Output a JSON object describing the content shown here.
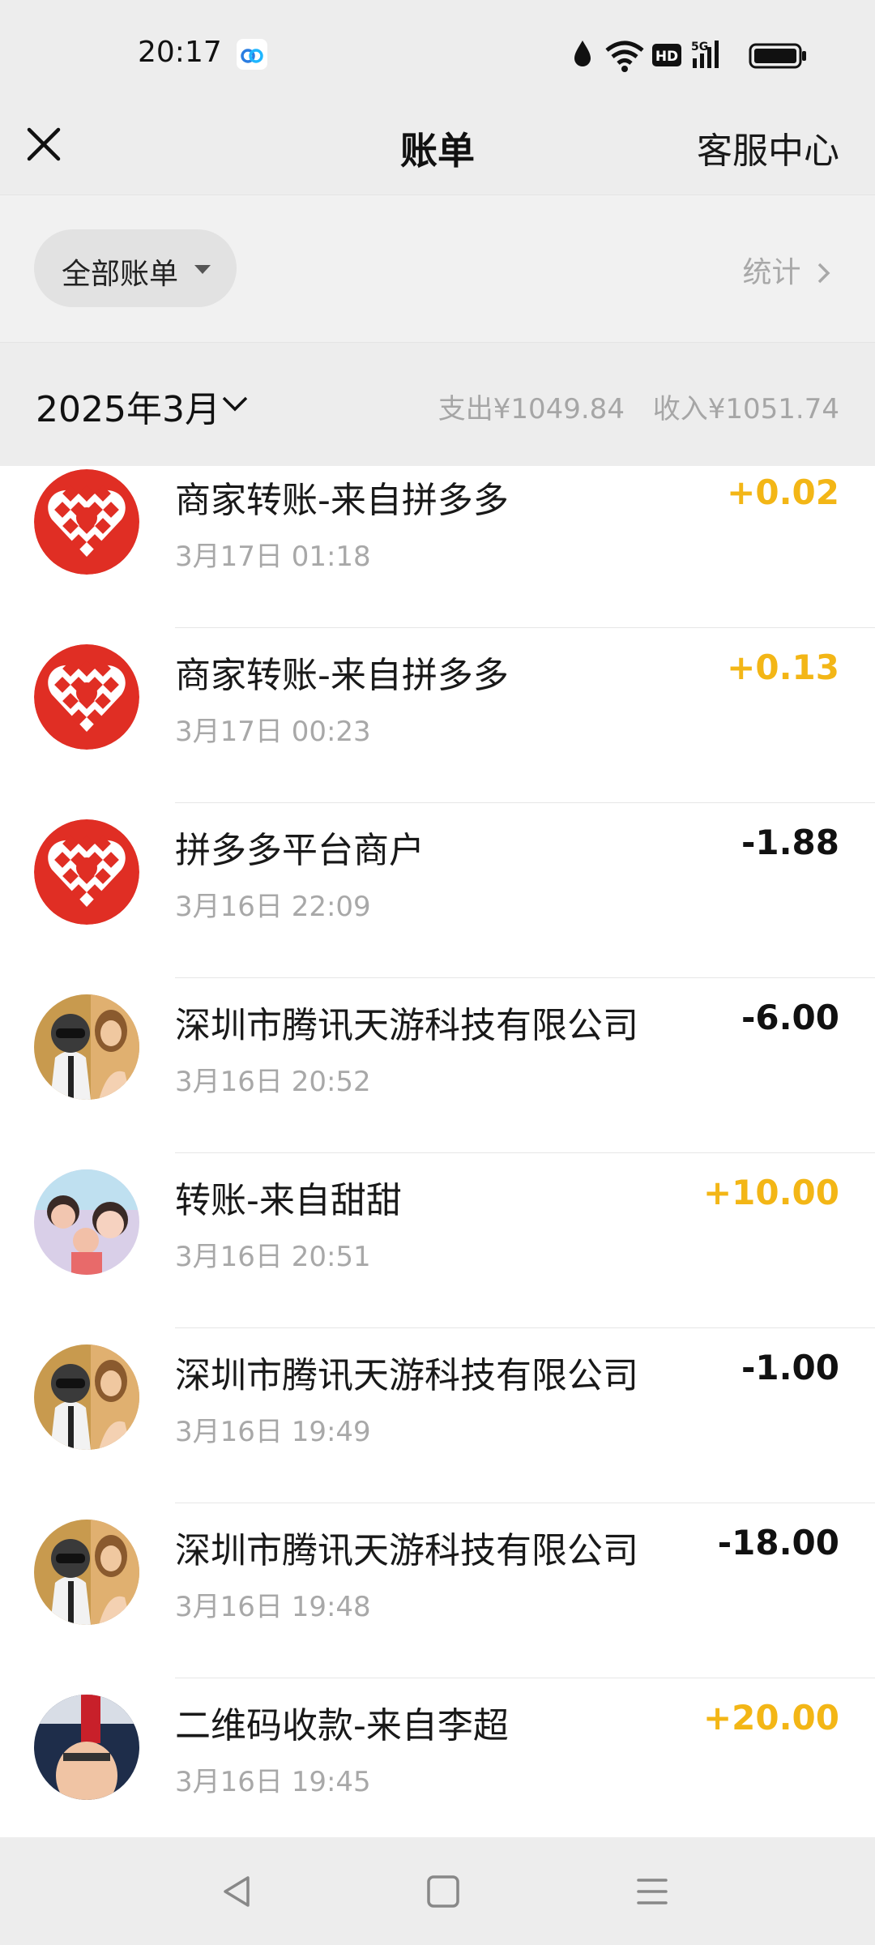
{
  "status_bar": {
    "time": "20:17",
    "icons": [
      "app-notification-icon",
      "water-drop-icon",
      "wifi-icon",
      "hd-icon",
      "5g-signal-icon",
      "battery-icon"
    ]
  },
  "header": {
    "title": "账单",
    "right_link": "客服中心",
    "close_icon": "close-icon"
  },
  "filter": {
    "label": "全部账单",
    "stats_label": "统计",
    "stats_chevron": "chevron-right-icon"
  },
  "month": {
    "label": "2025年3月",
    "expense": "支出¥1049.84",
    "income": "收入¥1051.74"
  },
  "transactions": [
    {
      "title": "商家转账-来自拼多多",
      "time": "3月17日 01:18",
      "amount": "+0.02",
      "type": "income",
      "avatar": "pinduoduo-logo"
    },
    {
      "title": "商家转账-来自拼多多",
      "time": "3月17日 00:23",
      "amount": "+0.13",
      "type": "income",
      "avatar": "pinduoduo-logo"
    },
    {
      "title": "拼多多平台商户",
      "time": "3月16日 22:09",
      "amount": "-1.88",
      "type": "expense",
      "avatar": "pinduoduo-logo"
    },
    {
      "title": "深圳市腾讯天游科技有限公司",
      "time": "3月16日 20:52",
      "amount": "-6.00",
      "type": "expense",
      "avatar": "game-avatar"
    },
    {
      "title": "转账-来自甜甜",
      "time": "3月16日 20:51",
      "amount": "+10.00",
      "type": "income",
      "avatar": "user-photo"
    },
    {
      "title": "深圳市腾讯天游科技有限公司",
      "time": "3月16日 19:49",
      "amount": "-1.00",
      "type": "expense",
      "avatar": "game-avatar"
    },
    {
      "title": "深圳市腾讯天游科技有限公司",
      "time": "3月16日 19:48",
      "amount": "-18.00",
      "type": "expense",
      "avatar": "game-avatar"
    },
    {
      "title": "二维码收款-来自李超",
      "time": "3月16日 19:45",
      "amount": "+20.00",
      "type": "income",
      "avatar": "user-photo-2"
    }
  ],
  "nav": {
    "icons": [
      "back-icon",
      "home-icon",
      "menu-icon"
    ]
  },
  "colors": {
    "background": "#ededed",
    "income": "#f3b616",
    "expense": "#111111",
    "pinduoduo_red": "#e02e24"
  }
}
